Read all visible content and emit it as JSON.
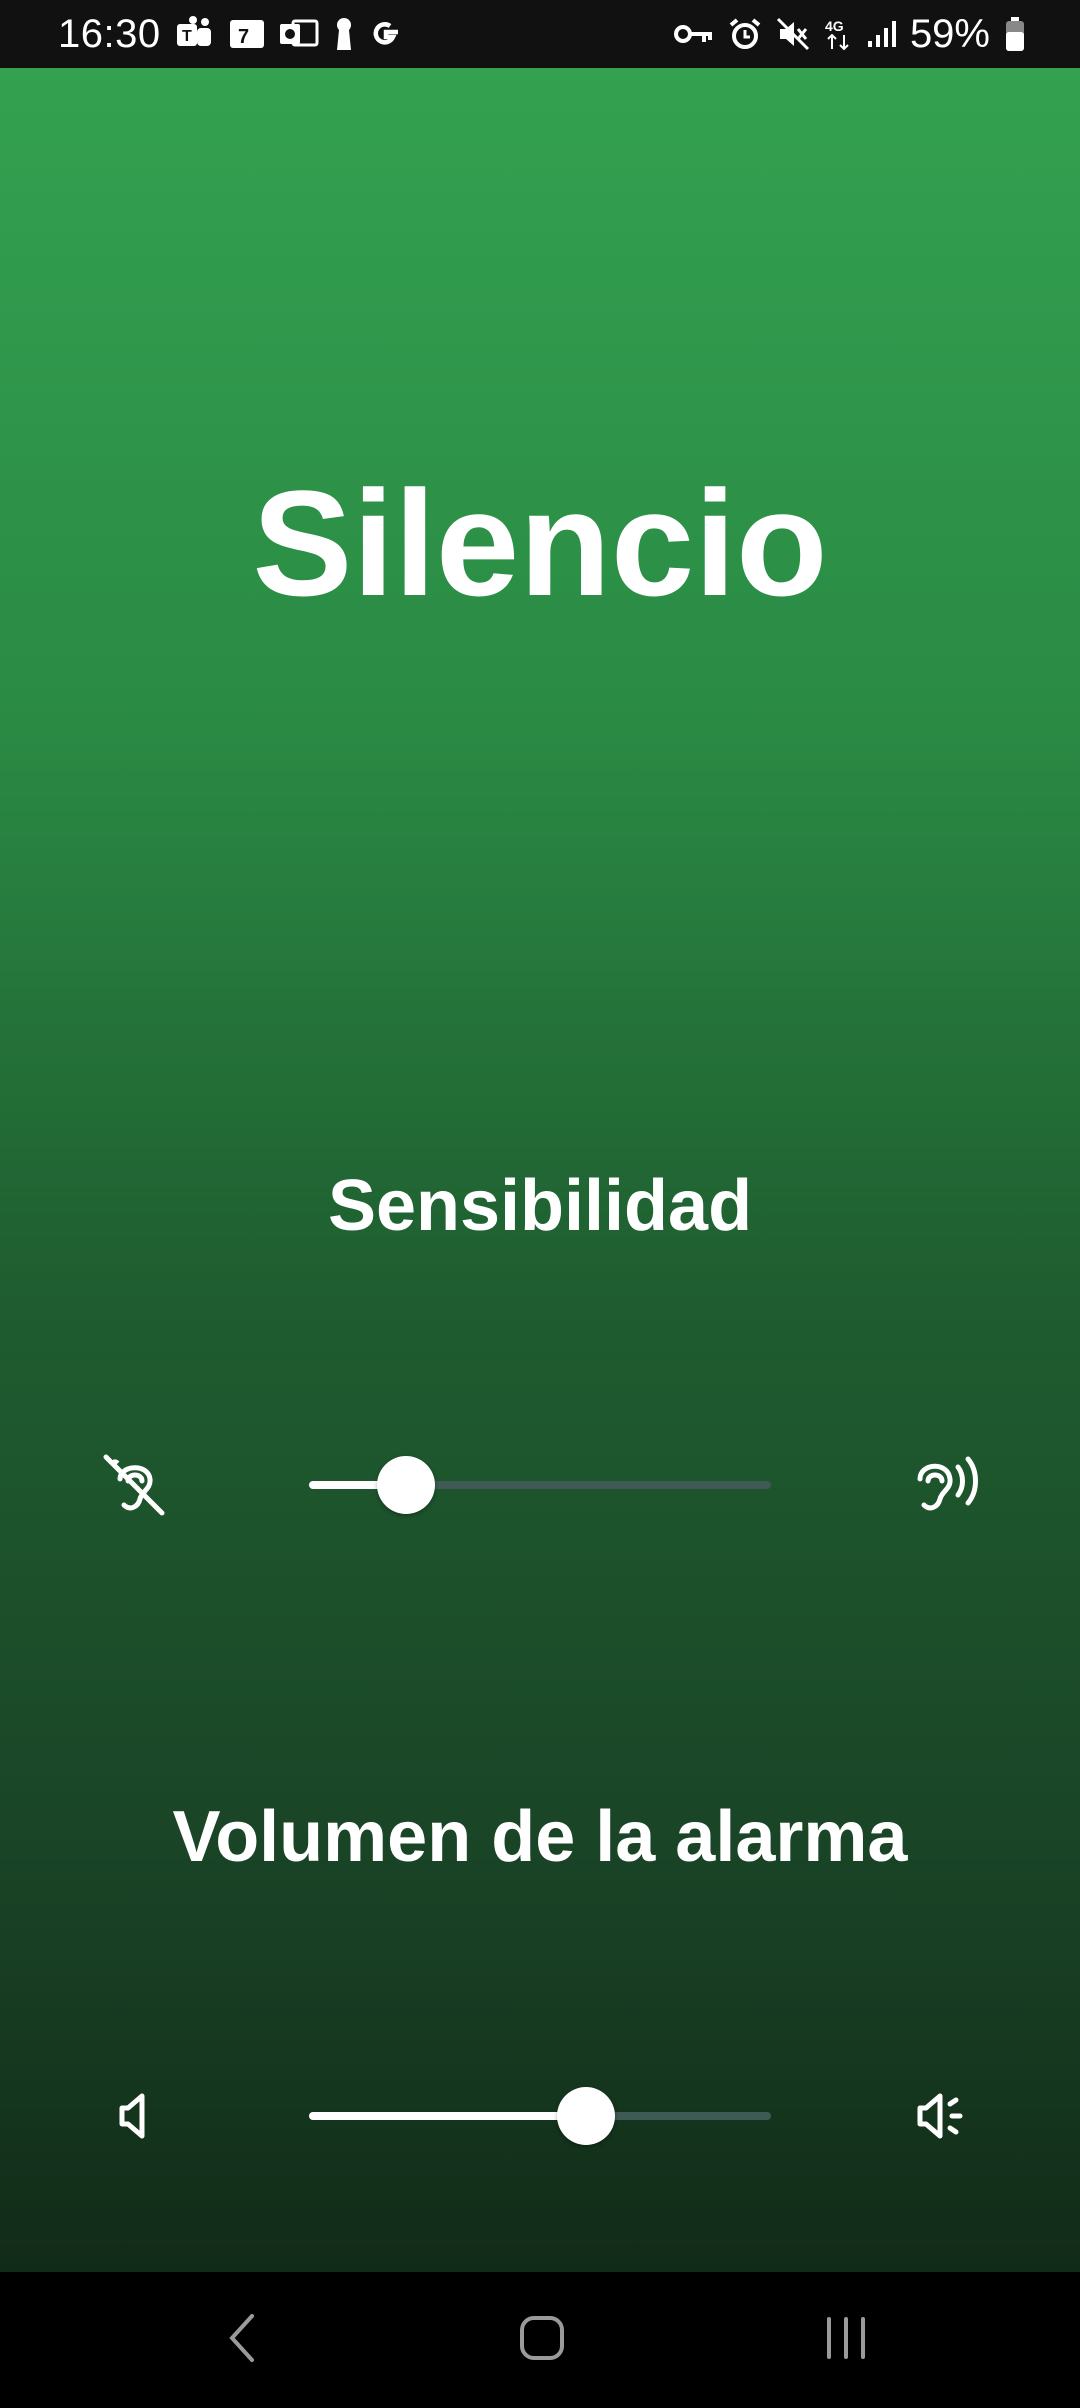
{
  "status_bar": {
    "time": "16:30",
    "battery_percent": "59%",
    "left_icons": [
      "teams-icon",
      "calendar-icon",
      "outlook-icon",
      "keyhole-icon",
      "google-icon"
    ],
    "right_icons": [
      "vpn-key-icon",
      "alarm-icon",
      "mute-icon",
      "4g-icon",
      "signal-icon",
      "battery-icon"
    ],
    "network_label": "4G"
  },
  "main": {
    "title": "Silencio",
    "sensitivity": {
      "label": "Sensibilidad",
      "value": 0.21,
      "left_icon": "hearing-disabled-icon",
      "right_icon": "hearing-icon"
    },
    "volume": {
      "label": "Volumen de la alarma",
      "value": 0.6,
      "left_icon": "volume-mute-icon",
      "right_icon": "volume-up-icon"
    }
  },
  "nav_bar": {
    "buttons": [
      "back-icon",
      "home-icon",
      "recents-icon"
    ]
  },
  "colors": {
    "gradient_top": "#33a150",
    "gradient_bottom": "#112b18",
    "track_inactive": "#3f5a54",
    "track_active": "#ffffff"
  }
}
